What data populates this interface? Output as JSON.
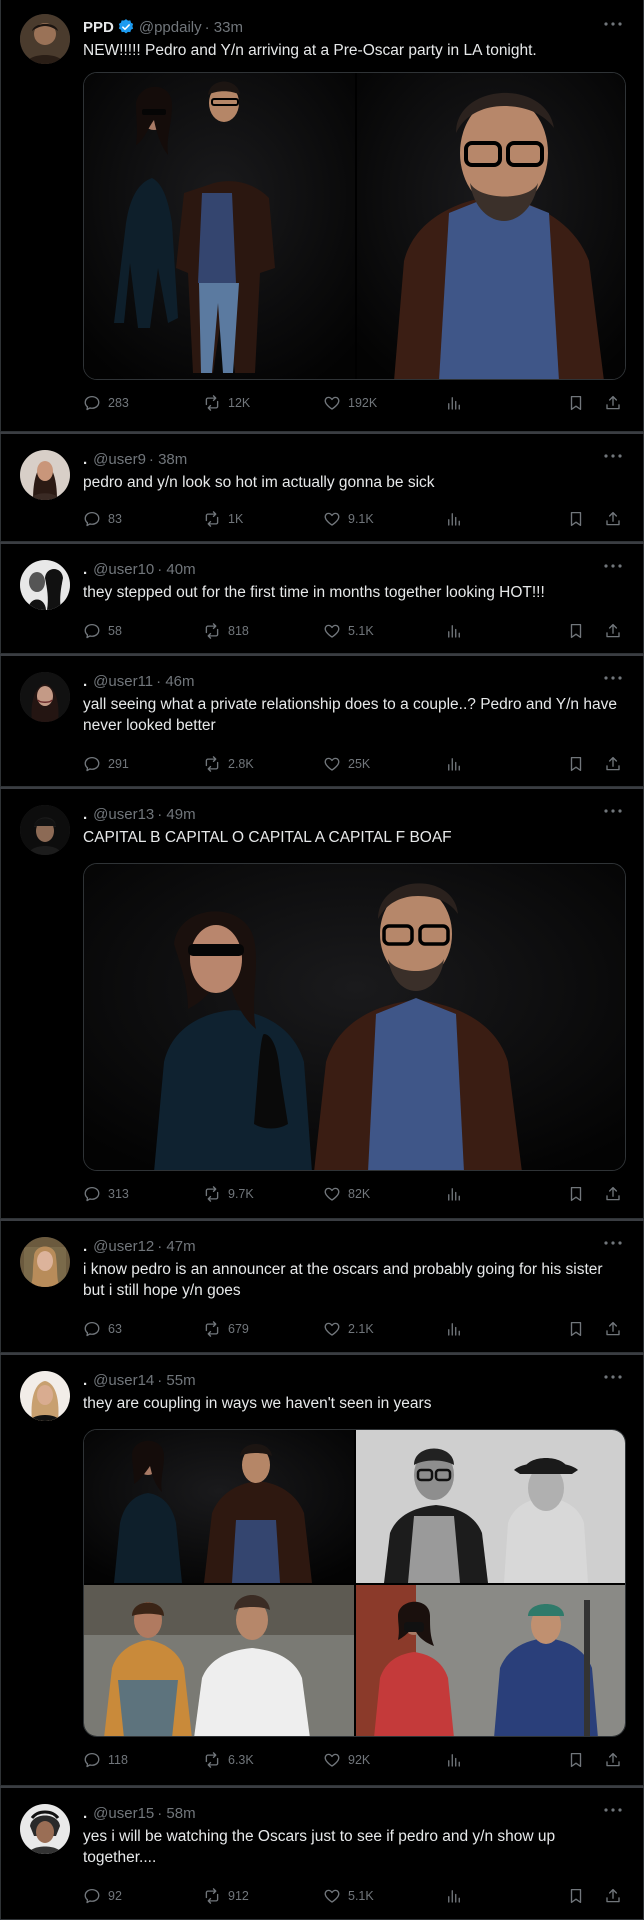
{
  "colors": {
    "background": "#000000",
    "text": "#e7e9ea",
    "muted": "#71767b",
    "border": "#2f3336",
    "verified": "#1d9bf0"
  },
  "icons": {
    "reply": "reply-icon",
    "repost": "repost-icon",
    "like": "heart-icon",
    "views": "views-icon",
    "bookmark": "bookmark-icon",
    "share": "share-icon",
    "more": "more-icon"
  },
  "tweets": [
    {
      "name": "PPD",
      "verified": true,
      "handle": "@ppdaily",
      "time": "· 33m",
      "text": "NEW!!!!! Pedro and Y/n arriving at a Pre-Oscar party in LA tonight.",
      "replies": "283",
      "reposts": "12K",
      "likes": "192K"
    },
    {
      "name": ".",
      "handle": "@user9",
      "time": "· 38m",
      "text": "pedro and y/n look so hot im actually gonna be sick",
      "replies": "83",
      "reposts": "1K",
      "likes": "9.1K"
    },
    {
      "name": ".",
      "handle": "@user10",
      "time": "· 40m",
      "text": "they stepped out for the first time in months together looking HOT!!!",
      "replies": "58",
      "reposts": "818",
      "likes": "5.1K"
    },
    {
      "name": ".",
      "handle": "@user11",
      "time": "· 46m",
      "text": "yall seeing what a private relationship does to a couple..? Pedro and Y/n have never looked better",
      "replies": "291",
      "reposts": "2.8K",
      "likes": "25K"
    },
    {
      "name": ".",
      "handle": "@user13",
      "time": "· 49m",
      "text": "CAPITAL B CAPITAL O CAPITAL A CAPITAL F BOAF",
      "replies": "313",
      "reposts": "9.7K",
      "likes": "82K"
    },
    {
      "name": ".",
      "handle": "@user12",
      "time": "· 47m",
      "text": "i know pedro is an announcer at the oscars and probably going for his sister but i still hope y/n goes",
      "replies": "63",
      "reposts": "679",
      "likes": "2.1K"
    },
    {
      "name": ".",
      "handle": "@user14",
      "time": "· 55m",
      "text": "they are coupling in ways we haven't seen in years",
      "replies": "118",
      "reposts": "6.3K",
      "likes": "92K"
    },
    {
      "name": ".",
      "handle": "@user15",
      "time": "· 58m",
      "text": "yes i will be watching the Oscars just to see if pedro and y/n show up together....",
      "replies": "92",
      "reposts": "912",
      "likes": "5.1K"
    }
  ]
}
